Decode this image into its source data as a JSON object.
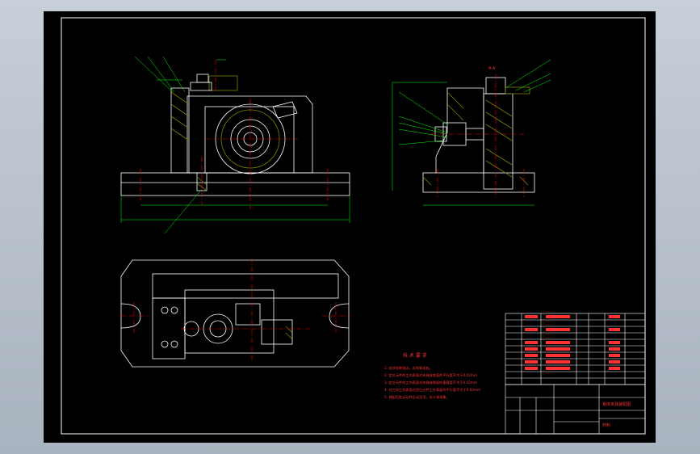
{
  "drawing": {
    "border_color": "#ffffff",
    "outline_color": "#ffffff",
    "dimension_color": "#00ff00",
    "centerline_color": "#ff0000",
    "hatch_color": "#808000",
    "note_color": "#ff3333"
  },
  "section_marker": "A-A",
  "tech_requirements": {
    "title": "技 术 要 求",
    "items": [
      "1. 去除毛刺锐边，去除氧化皮。",
      "2. 定位元件的工作表面对夹具体底面的平行度不大于0.02mm",
      "3. 定位元件的工作表面对夹具体侧面的垂直度不大于0.02mm",
      "4. 对刀块工作表面对定位元件工作表面的平行度不大于0.02mm",
      "5. 装配后各运动件运动灵活，无卡滞现象。"
    ]
  },
  "title_block": {
    "drawing_name": "铣床夹具装配图",
    "material_label": "材料"
  },
  "parts_list_icon": "parts-list-table"
}
